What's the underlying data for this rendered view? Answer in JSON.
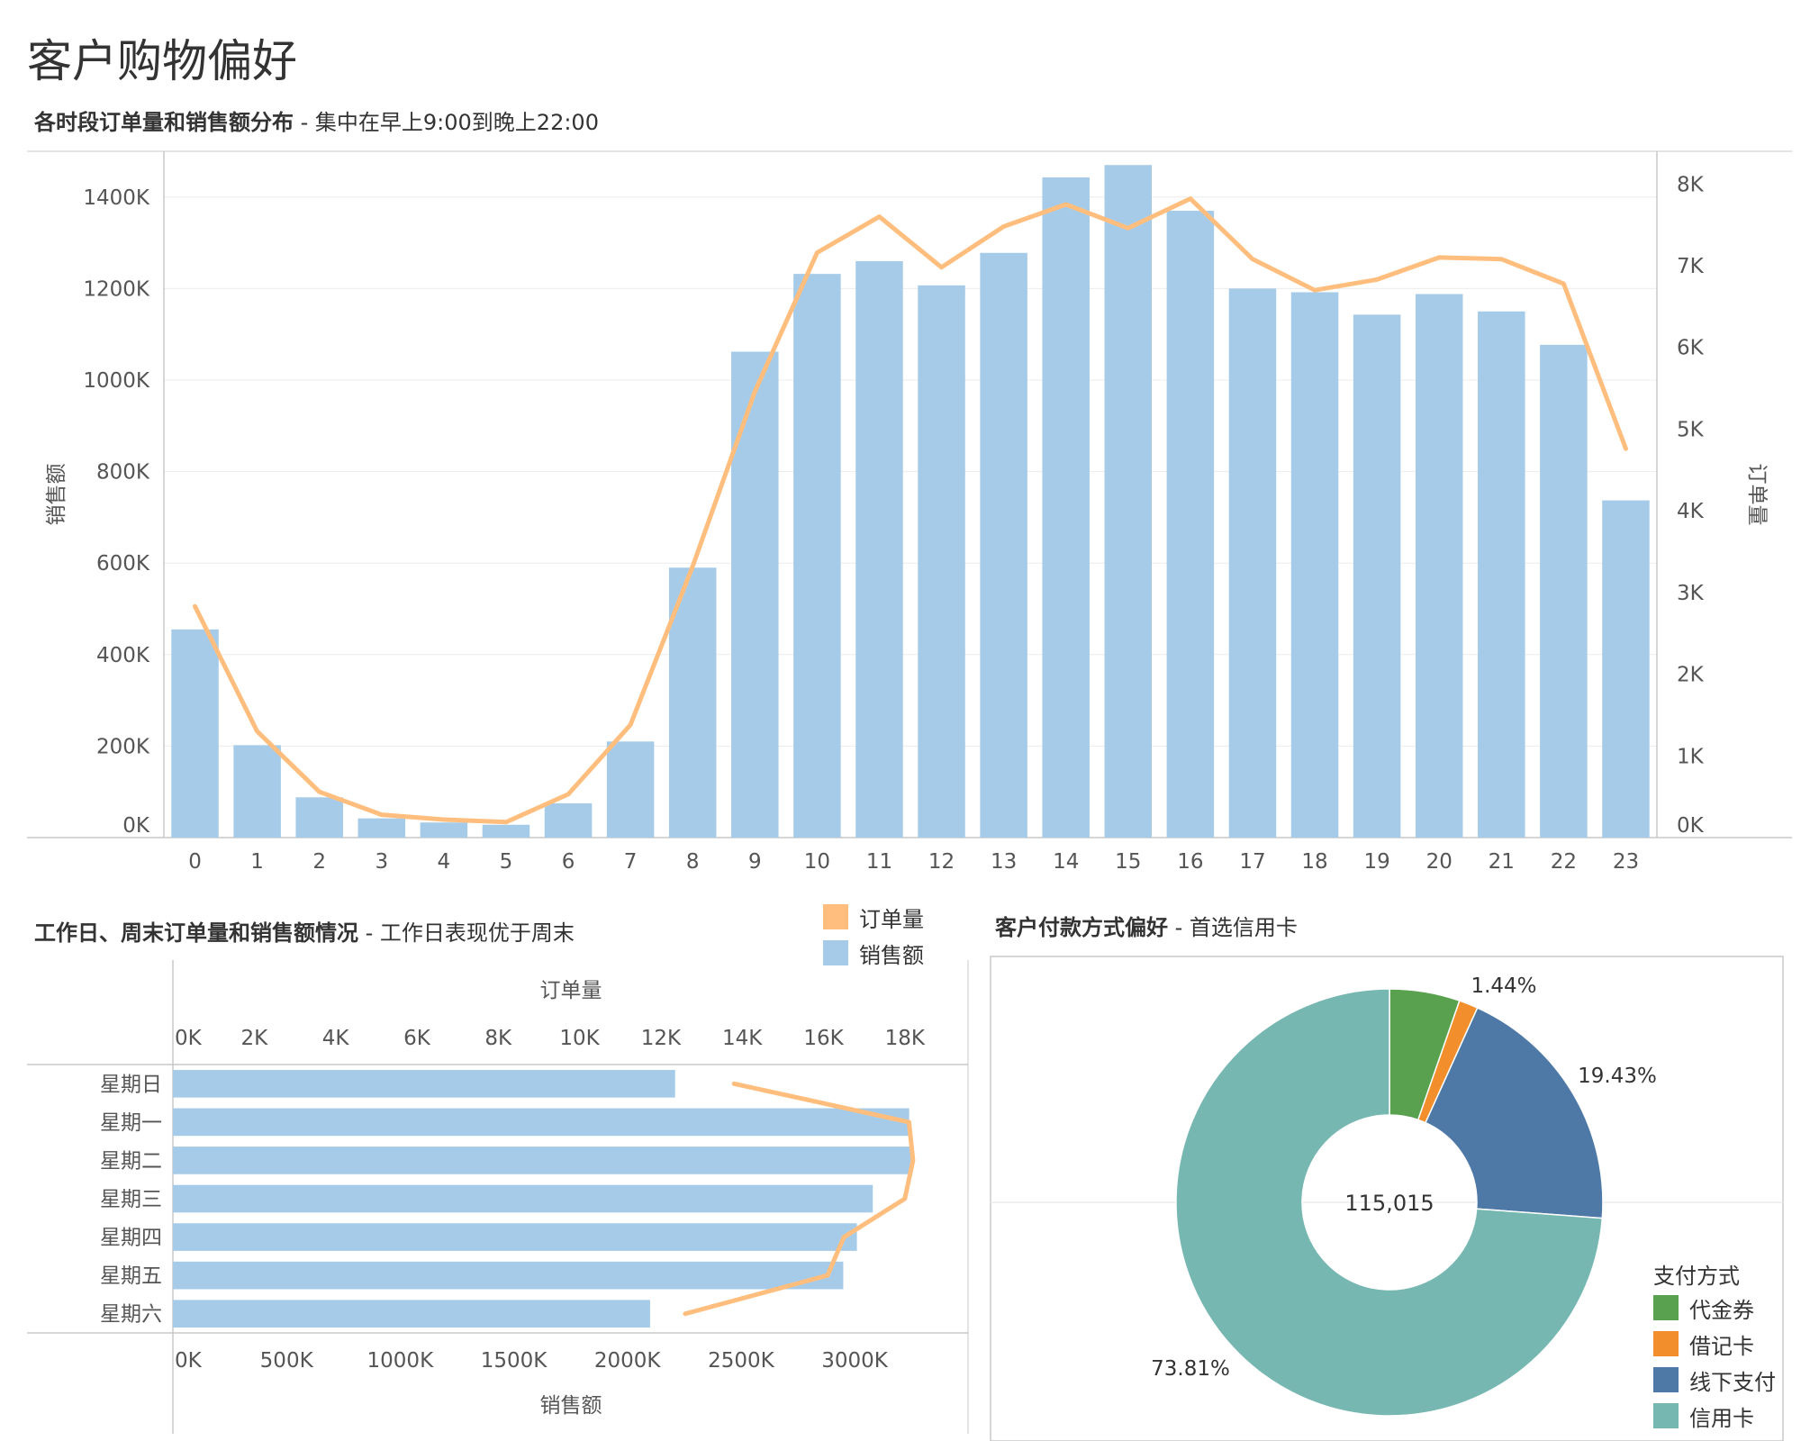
{
  "page": {
    "title": "客户购物偏好"
  },
  "hourly": {
    "title_bold": "各时段订单量和销售额分布",
    "title_rest": " - 集中在早上9:00到晚上22:00"
  },
  "weekday": {
    "title_bold": "工作日、周末订单量和销售额情况",
    "title_rest": " - 工作日表现优于周末"
  },
  "payment": {
    "title_bold": "客户付款方式偏好",
    "title_rest": " - 首选信用卡"
  },
  "measure_legend": {
    "items": [
      {
        "label": "订单量",
        "color": "#ffbe7d"
      },
      {
        "label": "销售额",
        "color": "#a6cbe8"
      }
    ]
  },
  "colors": {
    "bar": "#a6cbe8",
    "line": "#ffbe7d"
  },
  "chart_data": [
    {
      "type": "bar",
      "combo_line": true,
      "categories": [
        "0",
        "1",
        "2",
        "3",
        "4",
        "5",
        "6",
        "7",
        "8",
        "9",
        "10",
        "11",
        "12",
        "13",
        "14",
        "15",
        "16",
        "17",
        "18",
        "19",
        "20",
        "21",
        "22",
        "23"
      ],
      "series": [
        {
          "name": "销售额",
          "axis": "left",
          "type": "bar",
          "values": [
            455,
            202,
            88,
            42,
            33,
            28,
            75,
            210,
            590,
            1062,
            1232,
            1260,
            1207,
            1278,
            1443,
            1470,
            1370,
            1200,
            1192,
            1143,
            1188,
            1150,
            1077,
            737
          ]
        },
        {
          "name": "订单量",
          "axis": "right",
          "type": "line",
          "values": [
            2.83,
            1.3,
            0.56,
            0.28,
            0.22,
            0.19,
            0.53,
            1.38,
            3.32,
            5.46,
            7.16,
            7.6,
            6.98,
            7.48,
            7.75,
            7.46,
            7.82,
            7.08,
            6.7,
            6.83,
            7.1,
            7.08,
            6.78,
            4.76
          ]
        }
      ],
      "ylabel": "销售额",
      "y2label": "订单量",
      "ylim": [
        0,
        1500
      ],
      "y2lim": [
        0,
        8.4
      ],
      "yticks": [
        "0K",
        "200K",
        "400K",
        "600K",
        "800K",
        "1000K",
        "1200K",
        "1400K"
      ],
      "y2ticks": [
        "0K",
        "1K",
        "2K",
        "3K",
        "4K",
        "5K",
        "6K",
        "7K",
        "8K"
      ],
      "grid": true
    },
    {
      "type": "bar",
      "orientation": "horizontal",
      "combo_line": true,
      "categories": [
        "星期日",
        "星期一",
        "星期二",
        "星期三",
        "星期四",
        "星期五",
        "星期六"
      ],
      "series": [
        {
          "name": "销售额",
          "axis": "bottom",
          "type": "bar",
          "values": [
            2210,
            3240,
            3250,
            3080,
            3010,
            2950,
            2100
          ]
        },
        {
          "name": "订单量",
          "axis": "top",
          "type": "line",
          "values": [
            13.8,
            18.1,
            18.2,
            18.0,
            16.5,
            16.1,
            12.6
          ]
        }
      ],
      "xlabel": "销售额",
      "x2label": "订单量",
      "xlim": [
        0,
        3400
      ],
      "x2lim": [
        0,
        19.0
      ],
      "xticks": [
        "0K",
        "500K",
        "1000K",
        "1500K",
        "2000K",
        "2500K",
        "3000K"
      ],
      "x2ticks": [
        "0K",
        "2K",
        "4K",
        "6K",
        "8K",
        "10K",
        "12K",
        "14K",
        "16K",
        "18K"
      ]
    },
    {
      "type": "pie",
      "donut": true,
      "center_label": "115,015",
      "legend_title": "支付方式",
      "slices": [
        {
          "name": "代金券",
          "value": 5.32,
          "color": "#59a14f",
          "label": ""
        },
        {
          "name": "借记卡",
          "value": 1.44,
          "color": "#f28e2b",
          "label": "1.44%"
        },
        {
          "name": "线下支付",
          "value": 19.43,
          "color": "#4e79a7",
          "label": "19.43%"
        },
        {
          "name": "信用卡",
          "value": 73.81,
          "color": "#76b7b2",
          "label": "73.81%"
        }
      ]
    }
  ]
}
